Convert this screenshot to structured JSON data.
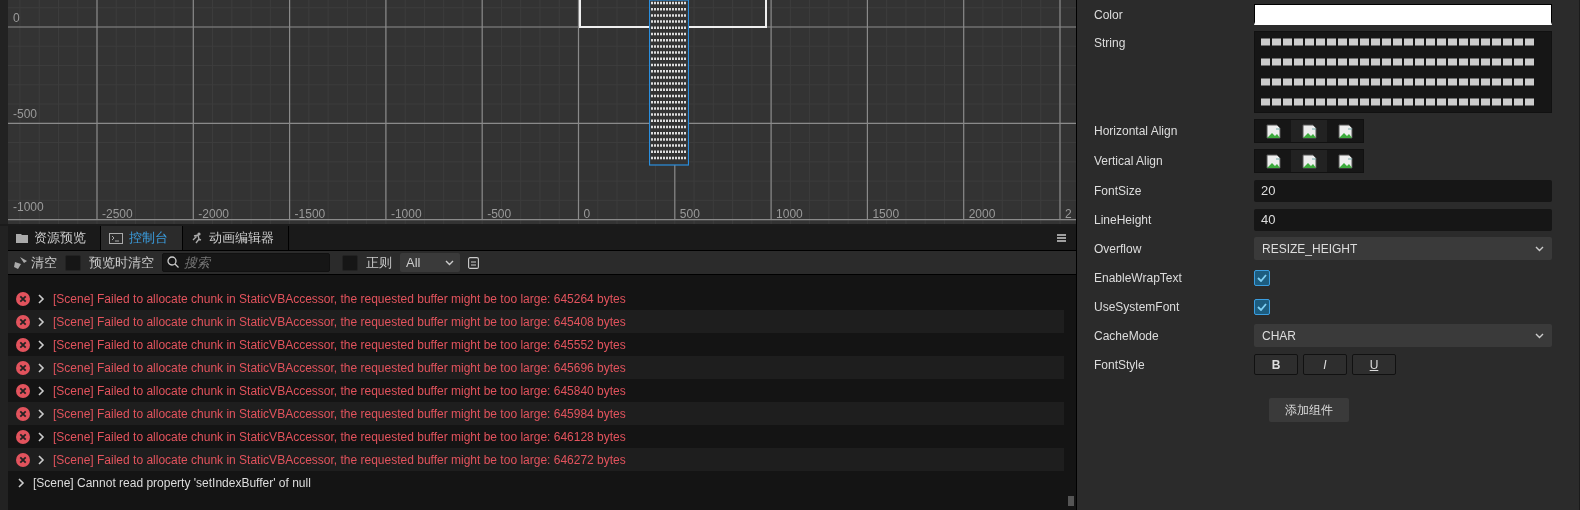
{
  "scene": {
    "x_labels": [
      "-2500",
      "-2000",
      "-1500",
      "-1000",
      "-500",
      "0",
      "500",
      "1000",
      "1500",
      "2000",
      "2"
    ],
    "y_labels": [
      "0",
      "-500",
      "-1000"
    ]
  },
  "console": {
    "tabs": [
      {
        "label": "资源预览",
        "selected": false
      },
      {
        "label": "控制台",
        "selected": true
      },
      {
        "label": "动画编辑器",
        "selected": false
      }
    ],
    "toolbar": {
      "clear": "清空",
      "clear_on_preview": {
        "label": "预览时清空",
        "checked": false
      },
      "search": {
        "placeholder": "搜索"
      },
      "regex": {
        "label": "正则",
        "checked": false
      },
      "filter": "All"
    },
    "logs": [
      {
        "kind": "error",
        "text": "[Scene] Failed to allocate chunk in StaticVBAccessor, the requested buffer might be too large: 645264 bytes"
      },
      {
        "kind": "error",
        "text": "[Scene] Failed to allocate chunk in StaticVBAccessor, the requested buffer might be too large: 645408 bytes"
      },
      {
        "kind": "error",
        "text": "[Scene] Failed to allocate chunk in StaticVBAccessor, the requested buffer might be too large: 645552 bytes"
      },
      {
        "kind": "error",
        "text": "[Scene] Failed to allocate chunk in StaticVBAccessor, the requested buffer might be too large: 645696 bytes"
      },
      {
        "kind": "error",
        "text": "[Scene] Failed to allocate chunk in StaticVBAccessor, the requested buffer might be too large: 645840 bytes"
      },
      {
        "kind": "error",
        "text": "[Scene] Failed to allocate chunk in StaticVBAccessor, the requested buffer might be too large: 645984 bytes"
      },
      {
        "kind": "error",
        "text": "[Scene] Failed to allocate chunk in StaticVBAccessor, the requested buffer might be too large: 646128 bytes"
      },
      {
        "kind": "error",
        "text": "[Scene] Failed to allocate chunk in StaticVBAccessor, the requested buffer might be too large: 646272 bytes"
      },
      {
        "kind": "info",
        "text": "[Scene] Cannot read property 'setIndexBuffer' of null"
      }
    ]
  },
  "inspector": {
    "properties": [
      {
        "kind": "color",
        "label": "Color",
        "color": "#ffffff"
      },
      {
        "kind": "text",
        "label": "String"
      },
      {
        "kind": "align",
        "label": "Horizontal Align"
      },
      {
        "kind": "align",
        "label": "Vertical Align"
      },
      {
        "kind": "number",
        "label": "FontSize",
        "value": "20"
      },
      {
        "kind": "number",
        "label": "LineHeight",
        "value": "40"
      },
      {
        "kind": "select",
        "label": "Overflow",
        "value": "RESIZE_HEIGHT"
      },
      {
        "kind": "checkbox",
        "label": "EnableWrapText",
        "checked": true
      },
      {
        "kind": "checkbox",
        "label": "UseSystemFont",
        "checked": true
      },
      {
        "kind": "select",
        "label": "CacheMode",
        "value": "CHAR"
      },
      {
        "kind": "fontstyle",
        "label": "FontStyle",
        "buttons": [
          "B",
          "I",
          "U"
        ]
      }
    ],
    "add_button": "添加组件"
  }
}
